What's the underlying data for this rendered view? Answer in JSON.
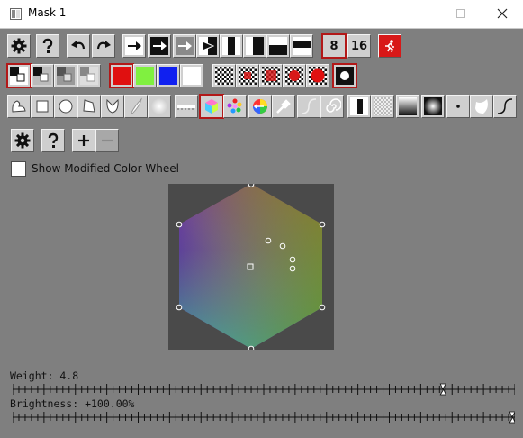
{
  "window": {
    "title": "Mask 1",
    "minimize_glyph": "—",
    "maximize_glyph": "☐",
    "close_glyph": "✕"
  },
  "toolbar1": {
    "bits_8_label": "8",
    "bits_16_label": "16"
  },
  "panel": {
    "show_modified_label": "Show Modified Color Wheel",
    "show_modified_checked": false
  },
  "sliders": {
    "weight_label": "Weight: 4.8",
    "weight_value": 4.8,
    "brightness_label": "Brightness: +100.00%",
    "brightness_value": 100.0
  },
  "colors": {
    "selection_outline": "#b21818",
    "swatch_red": "#e01010",
    "swatch_green": "#80f040",
    "swatch_blue": "#1020f0",
    "swatch_white": "#ffffff"
  }
}
